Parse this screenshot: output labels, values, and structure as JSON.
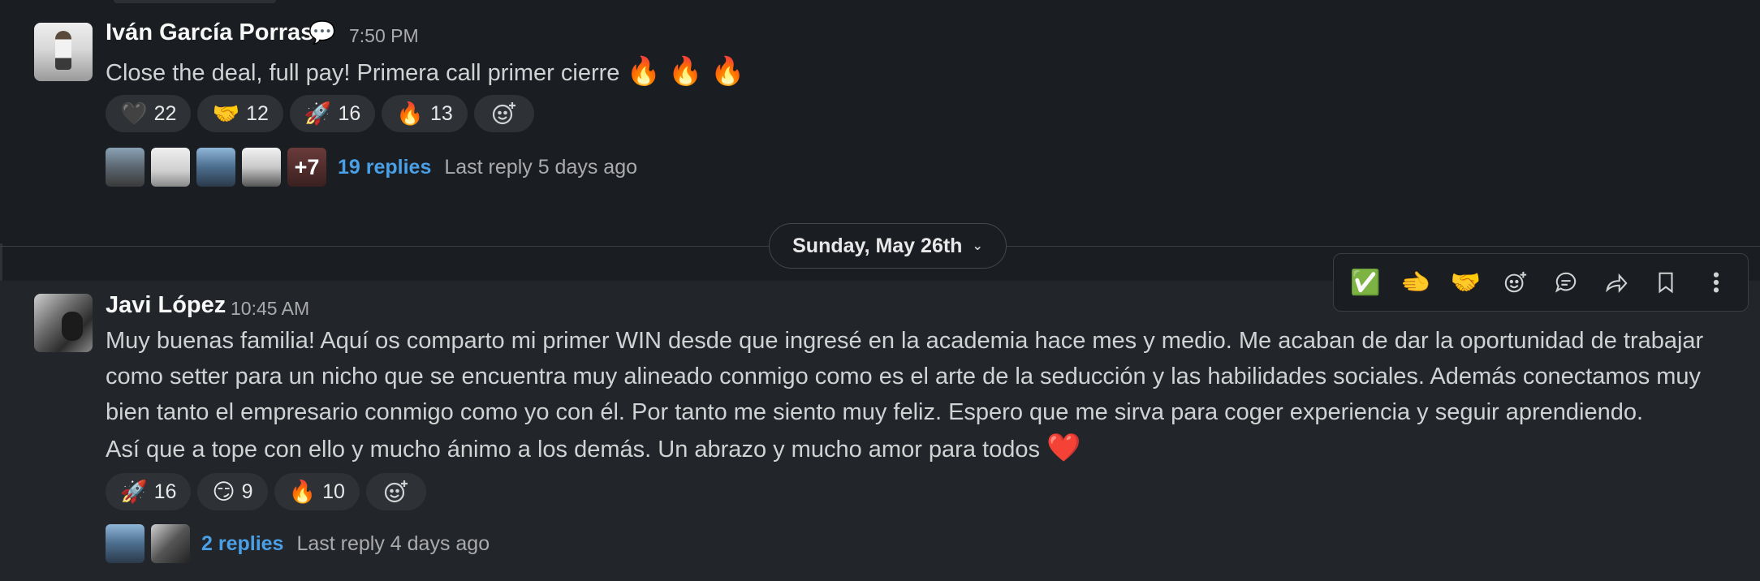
{
  "messages": [
    {
      "author": "Iván García Porras",
      "status_icon": "💬",
      "time": "7:50 PM",
      "text": "Close the deal, full pay! Primera call primer cierre",
      "trailing_emoji": "🔥 🔥 🔥",
      "reactions": [
        {
          "emoji": "🖤",
          "count": "22"
        },
        {
          "emoji": "🤝",
          "count": "12"
        },
        {
          "emoji": "🚀",
          "count": "16"
        },
        {
          "emoji": "🔥",
          "count": "13"
        }
      ],
      "thread": {
        "extra_count": "+7",
        "replies": "19 replies",
        "last_reply": "Last reply 5 days ago"
      }
    },
    {
      "author": "Javi López",
      "time": "10:45 AM",
      "lines": [
        "Muy buenas familia! Aquí os comparto mi primer WIN desde que ingresé en la academia hace mes y medio. Me acaban de dar la oportunidad de trabajar",
        "como setter para un nicho que se encuentra muy alineado conmigo como es el arte de la seducción y las habilidades sociales. Además conectamos muy",
        "bien tanto el empresario conmigo como yo con él. Por tanto me siento muy feliz. Espero que me sirva para coger experiencia y seguir aprendiendo.",
        "Así que a tope con ello y mucho ánimo a los demás. Un abrazo y mucho amor para todos"
      ],
      "trailing_emoji": "❤️",
      "reactions": [
        {
          "emoji": "🚀",
          "count": "16"
        },
        {
          "emoji": "😏",
          "count": "9"
        },
        {
          "emoji": "🔥",
          "count": "10"
        }
      ],
      "thread": {
        "replies": "2 replies",
        "last_reply": "Last reply 4 days ago"
      }
    }
  ],
  "date_divider": {
    "label": "Sunday, May 26th"
  },
  "toolbar": {
    "quick_reactions": [
      "✅",
      "🫲",
      "🤝"
    ],
    "icons": [
      "add-reaction-icon",
      "reply-thread-icon",
      "share-icon",
      "bookmark-icon",
      "more-actions-icon"
    ]
  },
  "colors": {
    "background": "#1a1d21",
    "hover_background": "#222529",
    "link": "#4aa0e6"
  }
}
